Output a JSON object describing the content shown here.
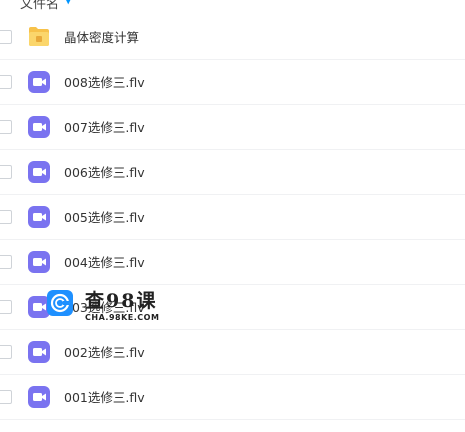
{
  "header": {
    "label": "文件名",
    "sort_icon": "sort-arrow-icon"
  },
  "files": [
    {
      "name": "晶体密度计算",
      "type": "folder",
      "icon": "folder-icon"
    },
    {
      "name": "008选修三.flv",
      "type": "video",
      "icon": "video-file-icon"
    },
    {
      "name": "007选修三.flv",
      "type": "video",
      "icon": "video-file-icon"
    },
    {
      "name": "006选修三.flv",
      "type": "video",
      "icon": "video-file-icon"
    },
    {
      "name": "005选修三.flv",
      "type": "video",
      "icon": "video-file-icon"
    },
    {
      "name": "004选修三.flv",
      "type": "video",
      "icon": "video-file-icon"
    },
    {
      "name": "003选修三.flv",
      "type": "video",
      "icon": "video-file-icon"
    },
    {
      "name": "002选修三.flv",
      "type": "video",
      "icon": "video-file-icon"
    },
    {
      "name": "001选修三.flv",
      "type": "video",
      "icon": "video-file-icon"
    }
  ],
  "watermark": {
    "title": "查98课",
    "subtitle": "CHA.98KE.COM"
  },
  "colors": {
    "folder": "#f7c24a",
    "video": "#7a73f0",
    "accent": "#0095ff",
    "watermark_logo": "#1e90ff"
  }
}
